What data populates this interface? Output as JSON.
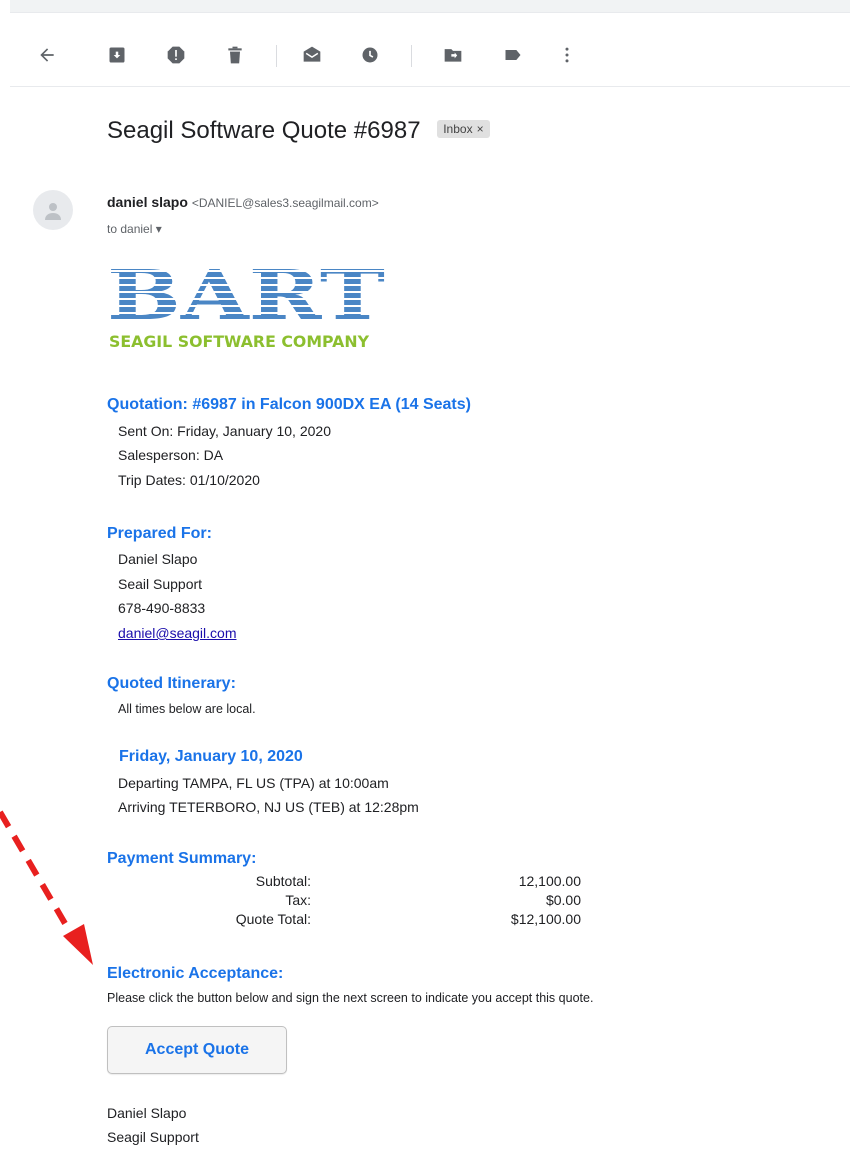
{
  "toolbar": {
    "back": "back-arrow-icon",
    "archive": "archive-icon",
    "spam": "report-spam-icon",
    "delete": "delete-icon",
    "mark_unread": "mark-unread-icon",
    "snooze": "snooze-icon",
    "move": "move-to-icon",
    "label": "label-icon",
    "more": "more-vert-icon"
  },
  "email": {
    "subject": "Seagil Software Quote #6987",
    "label_badge": "Inbox",
    "label_close": "×",
    "sender_name": "daniel slapo",
    "sender_email": "<DANIEL@sales3.seagilmail.com>",
    "to": "to daniel",
    "to_chevron": "▾"
  },
  "logo": {
    "wordmark": "BART",
    "tagline": "SEAGIL SOFTWARE COMPANY",
    "wordmark_color": "#4a86c5",
    "tagline_color": "#8cbf2f"
  },
  "quote": {
    "heading": "Quotation: #6987 in Falcon 900DX EA (14 Seats)",
    "sent_on": "Sent On: Friday, January 10, 2020",
    "salesperson": "Salesperson: DA",
    "trip_dates": "Trip Dates: 01/10/2020"
  },
  "prepared_for": {
    "heading": "Prepared For:",
    "name": "Daniel Slapo",
    "company": "Seail Support",
    "phone": "678-490-8833",
    "email": "daniel@seagil.com"
  },
  "itinerary": {
    "heading": "Quoted Itinerary:",
    "note": "All times below are local.",
    "date": "Friday, January 10, 2020",
    "departing": "Departing TAMPA, FL US (TPA) at 10:00am",
    "arriving": "Arriving TETERBORO, NJ US (TEB) at 12:28pm"
  },
  "payment": {
    "heading": "Payment Summary:",
    "rows": [
      {
        "label": "Subtotal:",
        "value": "12,100.00"
      },
      {
        "label": "Tax:",
        "value": "$0.00"
      },
      {
        "label": "Quote Total:",
        "value": "$12,100.00"
      }
    ]
  },
  "acceptance": {
    "heading": "Electronic Acceptance:",
    "instructions": "Please click the button below and sign the next screen to indicate you accept this quote.",
    "button_label": "Accept Quote"
  },
  "signature": {
    "name": "Daniel Slapo",
    "company": "Seagil Support"
  },
  "colors": {
    "heading_blue": "#1a73e8",
    "icon_gray": "#5f6368",
    "annotation_red": "#e8201f"
  }
}
